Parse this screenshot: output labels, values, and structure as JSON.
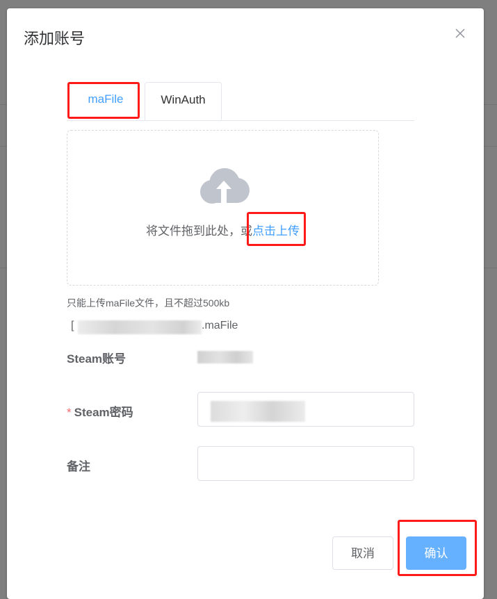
{
  "dialog": {
    "title": "添加账号",
    "close_icon": "close-icon"
  },
  "tabs": [
    {
      "label": "maFile",
      "active": true
    },
    {
      "label": "WinAuth",
      "active": false
    }
  ],
  "upload": {
    "icon": "cloud-upload-icon",
    "text": "将文件拖到此处，或",
    "link": "点击上传",
    "tip": "只能上传maFile文件，且不超过500kb"
  },
  "file": {
    "prefix": "[",
    "extension": ".maFile"
  },
  "form": {
    "account_label": "Steam账号",
    "password_required": "*",
    "password_label": "Steam密码",
    "remark_label": "备注",
    "remark_value": ""
  },
  "footer": {
    "cancel_label": "取消",
    "ok_label": "确认"
  },
  "colors": {
    "primary": "#409eff",
    "primary_light": "#66b1ff",
    "required": "#f56c6c",
    "annotation": "#ff1a1a"
  }
}
